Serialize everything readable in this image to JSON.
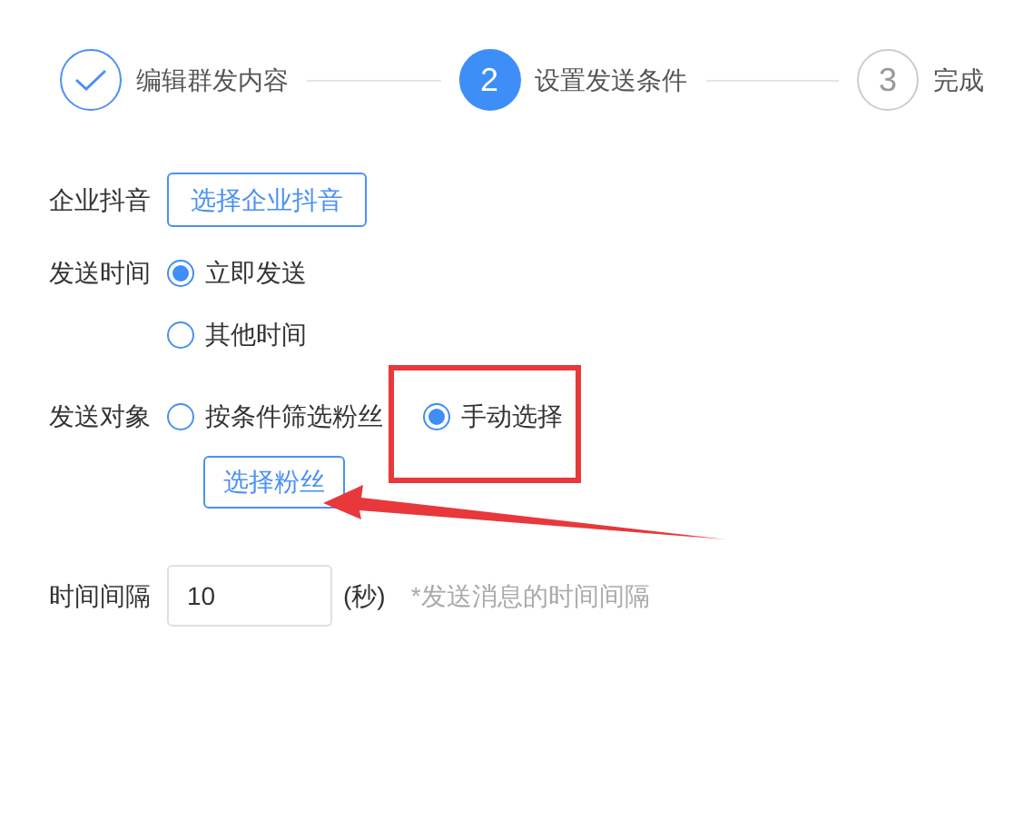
{
  "steps": [
    {
      "label": "编辑群发内容",
      "kind": "finished"
    },
    {
      "number": "2",
      "label": "设置发送条件",
      "kind": "current"
    },
    {
      "number": "3",
      "label": "完成",
      "kind": "waiting"
    }
  ],
  "form": {
    "account": {
      "label": "企业抖音",
      "button": "选择企业抖音"
    },
    "send_time": {
      "label": "发送时间",
      "options": [
        {
          "label": "立即发送",
          "selected": true
        },
        {
          "label": "其他时间",
          "selected": false
        }
      ]
    },
    "target": {
      "label": "发送对象",
      "options": [
        {
          "label": "按条件筛选粉丝",
          "selected": false
        },
        {
          "label": "手动选择",
          "selected": true
        }
      ],
      "button": "选择粉丝"
    },
    "interval": {
      "label": "时间间隔",
      "value": "10",
      "unit": "(秒)",
      "hint": "*发送消息的时间间隔"
    }
  }
}
